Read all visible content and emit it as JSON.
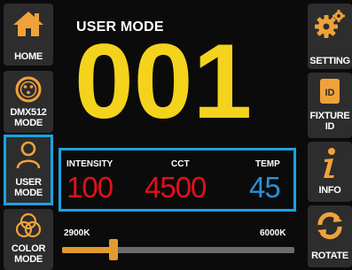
{
  "left_nav": {
    "home": "HOME",
    "dmx_line1": "DMX512",
    "dmx_line2": "MODE",
    "user_line1": "USER",
    "user_line2": "MODE",
    "color_line1": "COLOR",
    "color_line2": "MODE"
  },
  "right_nav": {
    "setting": "SETTING",
    "fixture_line1": "FIXTURE",
    "fixture_line2": "ID",
    "info": "INFO",
    "rotate": "ROTATE"
  },
  "main": {
    "title": "USER MODE",
    "number": "001"
  },
  "params": {
    "intensity_label": "INTENSITY",
    "intensity_value": "100",
    "cct_label": "CCT",
    "cct_value": "4500",
    "temp_label": "TEMP",
    "temp_value": "45"
  },
  "slider": {
    "min_label": "2900K",
    "max_label": "6000K",
    "level_fraction": 0.22
  },
  "colors": {
    "accent": "#1aa3e0",
    "number": "#f4d31c",
    "value_red": "#e3101a",
    "value_blue": "#2b8fd6",
    "slider": "#e39a2e",
    "icon_orange": "#f0a23a"
  }
}
